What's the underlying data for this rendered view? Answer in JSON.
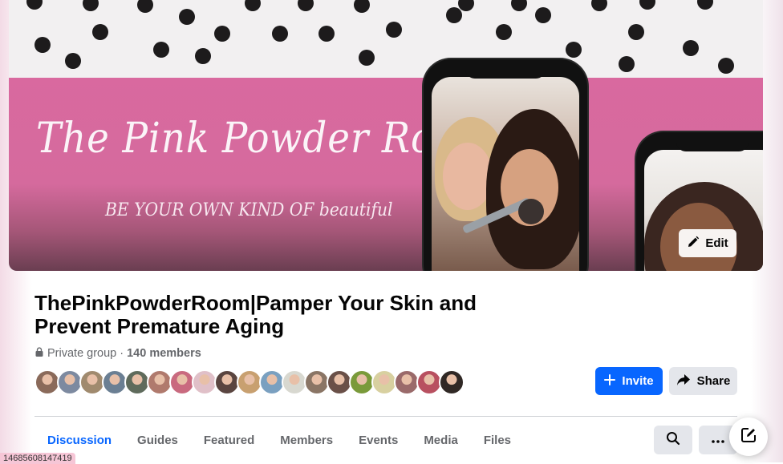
{
  "cover": {
    "title": "The Pink Powder Room",
    "tagline": "BE YOUR OWN KIND OF beautiful",
    "edit_label": "Edit"
  },
  "group": {
    "name": "ThePinkPowderRoom|Pamper Your Skin and Prevent Premature Aging",
    "privacy": "Private group",
    "separator": "·",
    "members": "140 members"
  },
  "actions": {
    "invite_label": "Invite",
    "share_label": "Share"
  },
  "tabs": [
    {
      "label": "Discussion",
      "active": true
    },
    {
      "label": "Guides"
    },
    {
      "label": "Featured"
    },
    {
      "label": "Members"
    },
    {
      "label": "Events"
    },
    {
      "label": "Media"
    },
    {
      "label": "Files"
    }
  ],
  "tools": {
    "search_icon": "search-icon",
    "more_icon": "more-icon",
    "compose_icon": "compose-icon"
  },
  "avatar_colors": [
    "#8a6a5a",
    "#7d8aa0",
    "#a08a6e",
    "#6b7f93",
    "#5f6b5c",
    "#b07a6d",
    "#c96a7f",
    "#e0c0c8",
    "#5a4540",
    "#c8a070",
    "#7aa0c0",
    "#d8d8d0",
    "#8a7565",
    "#6a5048",
    "#7a9a3a",
    "#d8d0a0",
    "#9a6a6a",
    "#b85060",
    "#302825"
  ],
  "colors": {
    "accent": "#0866ff",
    "secondary_text": "#65676b",
    "button_gray": "#e4e6eb",
    "cover_pink": "#d9699f"
  },
  "debug": {
    "id": "14685608147419"
  }
}
